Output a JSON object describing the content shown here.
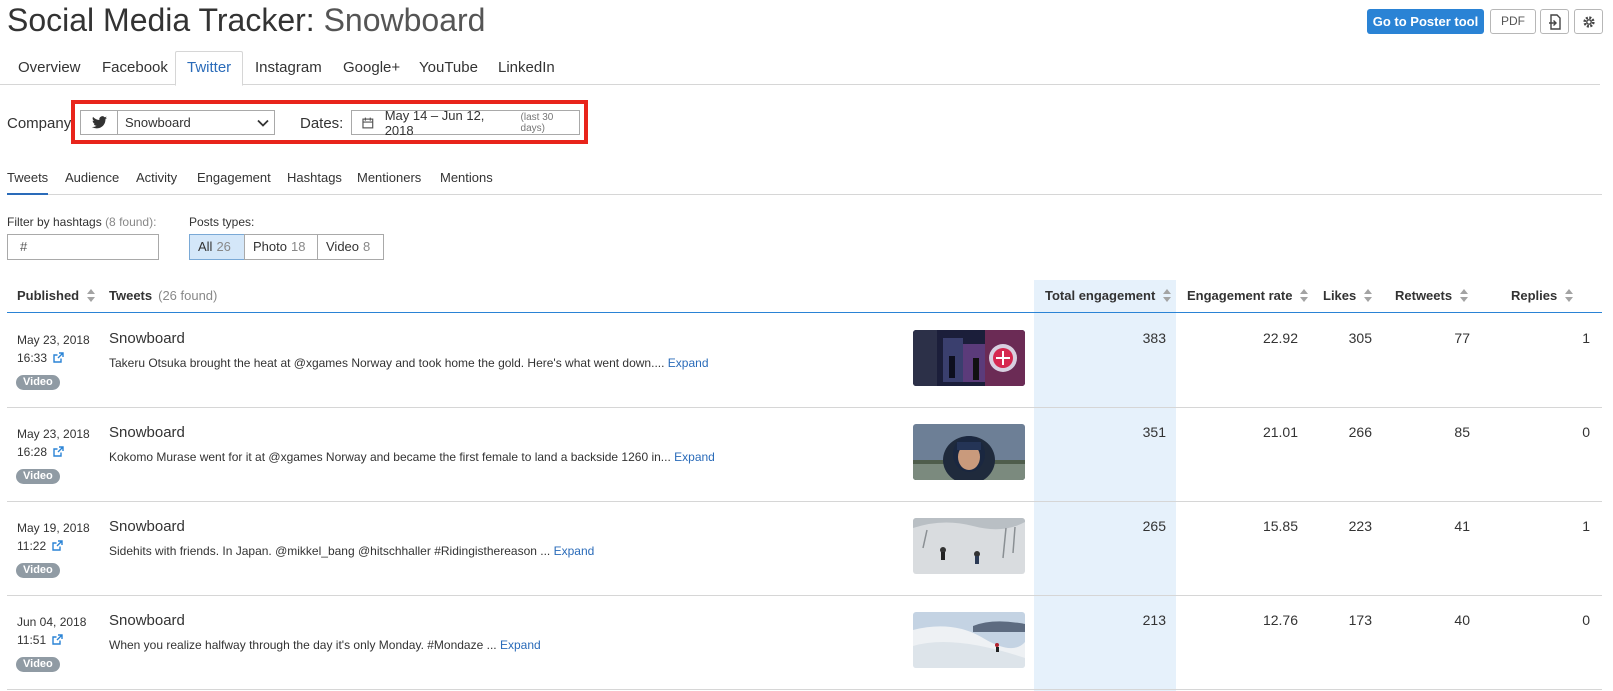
{
  "header": {
    "title": "Social Media Tracker:",
    "company": "Snowboard",
    "poster_button": "Go to Poster tool",
    "pdf_button": "PDF"
  },
  "main_tabs": [
    "Overview",
    "Facebook",
    "Twitter",
    "Instagram",
    "Google+",
    "YouTube",
    "LinkedIn"
  ],
  "main_tab_active": "Twitter",
  "filters": {
    "company_label": "Company:",
    "company_value": "Snowboard",
    "dates_label": "Dates:",
    "dates_value": "May 14 – Jun 12, 2018",
    "dates_hint": "(last 30 days)"
  },
  "sub_tabs": [
    "Tweets",
    "Audience",
    "Activity",
    "Engagement",
    "Hashtags",
    "Mentioners",
    "Mentions"
  ],
  "sub_tab_active": "Tweets",
  "hashtag_filter": {
    "label": "Filter by hashtags",
    "count": "(8 found):",
    "placeholder": "#"
  },
  "post_types": {
    "label": "Posts types:",
    "options": [
      {
        "label": "All",
        "count": "26"
      },
      {
        "label": "Photo",
        "count": "18"
      },
      {
        "label": "Video",
        "count": "8"
      }
    ]
  },
  "table": {
    "columns": {
      "published": "Published",
      "tweets": "Tweets",
      "tweets_count": "(26 found)",
      "total_engagement": "Total engagement",
      "engagement_rate": "Engagement rate",
      "likes": "Likes",
      "retweets": "Retweets",
      "replies": "Replies"
    },
    "rows": [
      {
        "date": "May 23, 2018",
        "time": "16:33",
        "type": "Video",
        "account": "Snowboard",
        "text": "Takeru Otsuka brought the heat at @xgames Norway and took home the gold. Here's what went down....",
        "expand": "Expand",
        "total": "383",
        "rate": "22.92",
        "likes": "305",
        "retweets": "77",
        "replies": "1"
      },
      {
        "date": "May 23, 2018",
        "time": "16:28",
        "type": "Video",
        "account": "Snowboard",
        "text": "Kokomo Murase went for it at @xgames Norway and became the first female to land a backside 1260 in...",
        "expand": "Expand",
        "total": "351",
        "rate": "21.01",
        "likes": "266",
        "retweets": "85",
        "replies": "0"
      },
      {
        "date": "May 19, 2018",
        "time": "11:22",
        "type": "Video",
        "account": "Snowboard",
        "text": "Sidehits with friends. In Japan. @mikkel_bang @hitschhaller #Ridingisthereason ...",
        "expand": "Expand",
        "total": "265",
        "rate": "15.85",
        "likes": "223",
        "retweets": "41",
        "replies": "1"
      },
      {
        "date": "Jun 04, 2018",
        "time": "11:51",
        "type": "Video",
        "account": "Snowboard",
        "text": "When you realize halfway through the day it's only Monday. #Mondaze ...",
        "expand": "Expand",
        "total": "213",
        "rate": "12.76",
        "likes": "173",
        "retweets": "40",
        "replies": "0"
      }
    ]
  },
  "colors": {
    "accent": "#2a83d5",
    "highlight_box": "#e8241b",
    "active_column_bg": "#e6f1fb",
    "badge": "#909ba4"
  }
}
